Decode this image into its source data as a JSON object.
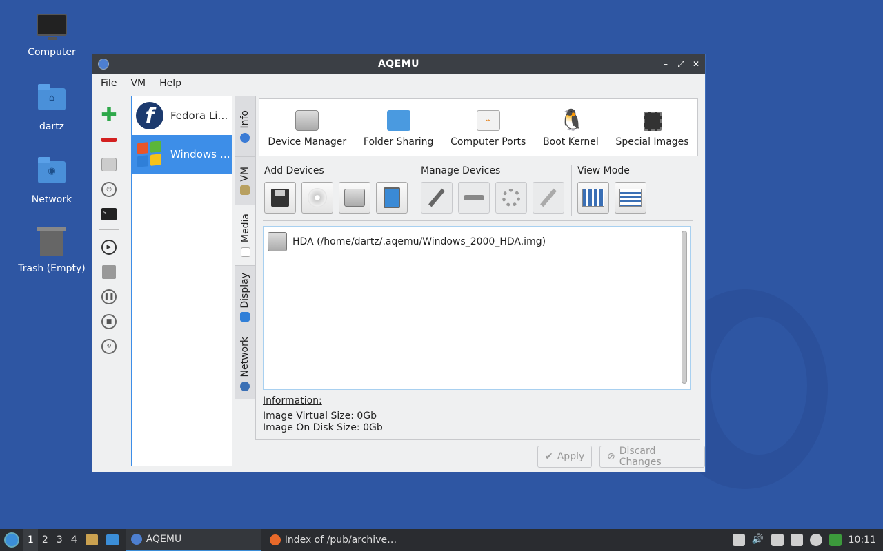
{
  "desktop": {
    "icons": [
      {
        "label": "Computer",
        "icon": "monitor-icon"
      },
      {
        "label": "dartz",
        "icon": "home-folder-icon"
      },
      {
        "label": "Network",
        "icon": "network-folder-icon"
      },
      {
        "label": "Trash (Empty)",
        "icon": "trash-icon"
      }
    ]
  },
  "window": {
    "title": "AQEMU",
    "controls": {
      "minimize": "–",
      "maximize": "⤢",
      "close": "✕"
    },
    "menu": [
      "File",
      "VM",
      "Help"
    ],
    "vm_list": [
      {
        "name": "Fedora Li…",
        "selected": false
      },
      {
        "name": "Windows …",
        "selected": true
      }
    ],
    "tabs": [
      {
        "label": "Info",
        "active": false
      },
      {
        "label": "VM",
        "active": false
      },
      {
        "label": "Media",
        "active": true
      },
      {
        "label": "Display",
        "active": false
      },
      {
        "label": "Network",
        "active": false
      }
    ],
    "top_toolbar": [
      {
        "label": "Device Manager",
        "icon": "hard-disk-icon"
      },
      {
        "label": "Folder Sharing",
        "icon": "folder-icon"
      },
      {
        "label": "Computer Ports",
        "icon": "usb-icon"
      },
      {
        "label": "Boot Kernel",
        "icon": "tux-icon"
      },
      {
        "label": "Special Images",
        "icon": "chip-icon"
      }
    ],
    "groups": {
      "add": "Add Devices",
      "manage": "Manage Devices",
      "view": "View Mode"
    },
    "devices": [
      {
        "label": "HDA (/home/dartz/.aqemu/Windows_2000_HDA.img)"
      }
    ],
    "information": {
      "heading": "Information:",
      "virtual_size": "Image Virtual Size: 0Gb",
      "disk_size": "Image On Disk Size: 0Gb"
    },
    "buttons": {
      "apply": "Apply",
      "discard": "Discard Changes"
    }
  },
  "taskbar": {
    "workspaces": [
      "1",
      "2",
      "3",
      "4"
    ],
    "tasks": [
      {
        "label": "AQEMU",
        "active": true
      },
      {
        "label": "Index of /pub/archive…",
        "active": false
      }
    ],
    "clock": "10:11"
  },
  "colors": {
    "desktop": "#2e56a3",
    "selection": "#3d8ee8",
    "titlebar": "#3b3f45",
    "taskbar": "#2a2c30"
  }
}
